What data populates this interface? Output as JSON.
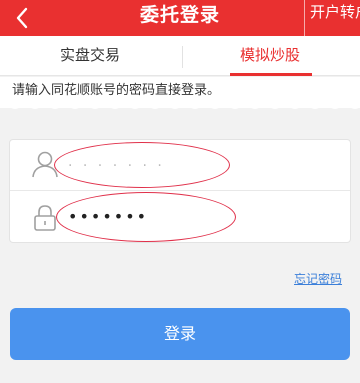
{
  "topbar": {
    "title": "委托登录",
    "right_action": "开户转户",
    "background": "#e93030"
  },
  "tabs": [
    {
      "label": "实盘交易",
      "active": false
    },
    {
      "label": "模拟炒股",
      "active": true
    }
  ],
  "hint": "请输入同花顺账号的密码直接登录。",
  "form": {
    "username_value": "· · · · · · ·",
    "password_value": "•••••••"
  },
  "forgot_password": "忘记密码",
  "login_button": "登录",
  "colors": {
    "accent_red": "#e93030",
    "button_blue": "#4a93ee",
    "link_blue": "#3b7fd9"
  },
  "icons": {
    "back": "back-arrow-icon",
    "user": "user-icon",
    "lock": "lock-icon"
  }
}
